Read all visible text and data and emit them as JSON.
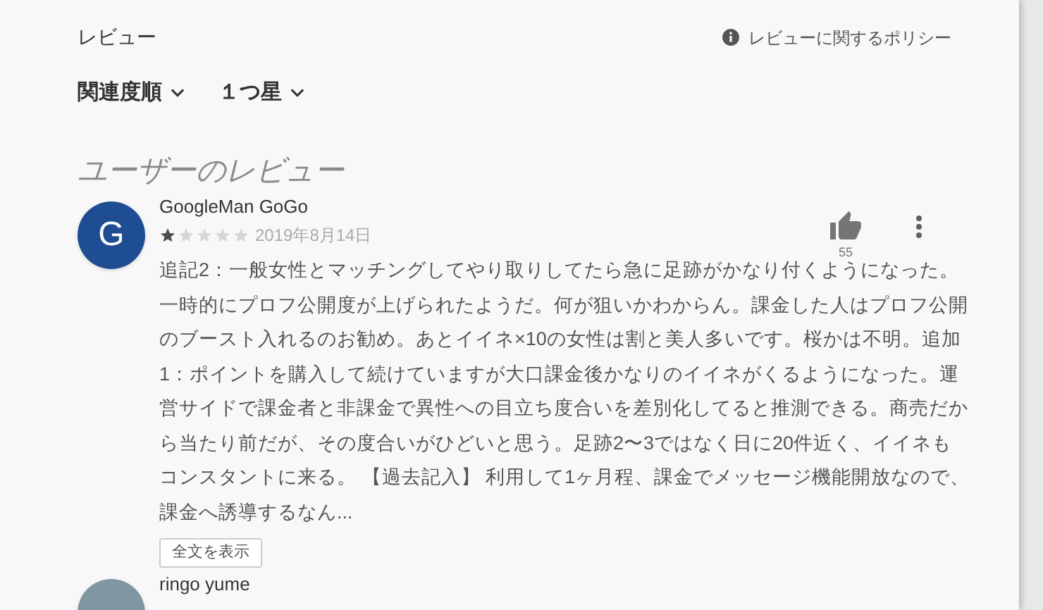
{
  "header": {
    "title": "レビュー",
    "policy_link": "レビューに関するポリシー"
  },
  "filters": [
    {
      "label": "関連度順"
    },
    {
      "label": "１つ星"
    }
  ],
  "section_title": "ユーザーのレビュー",
  "reviews": [
    {
      "avatar_letter": "G",
      "color": "#1e4d94",
      "name": "GoogleMan GoGo",
      "stars": 1,
      "date": "2019年8月14日",
      "likes": "55",
      "text": "追記2：一般女性とマッチングしてやり取りしてたら急に足跡がかなり付くようになった。一時的にプロフ公開度が上げられたようだ。何が狙いかわからん。課金した人はプロフ公開のブースト入れるのお勧め。あとイイネ×10の女性は割と美人多いです。桜かは不明。追加1：ポイントを購入して続けていますが大口課金後かなりのイイネがくるようになった。運営サイドで課金者と非課金で異性への目立ち度合いを差別化してると推測できる。商売だから当たり前だが、その度合いがひどいと思う。足跡2〜3ではなく日に20件近く、イイネもコンスタントに来る。 【過去記入】 利用して1ヶ月程、課金でメッセージ機能開放なので、課金へ誘導するなん...",
      "expand_button": "全文を表示"
    },
    {
      "color": "#7f97a3",
      "name": "ringo yume"
    }
  ]
}
